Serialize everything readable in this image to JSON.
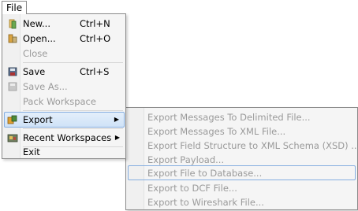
{
  "menubar": {
    "file_label": "File"
  },
  "file_menu": {
    "items": [
      {
        "label": "New...",
        "shortcut": "Ctrl+N",
        "icon": "new-file-icon",
        "enabled": true
      },
      {
        "label": "Open...",
        "shortcut": "Ctrl+O",
        "icon": "open-folder-icon",
        "enabled": true
      },
      {
        "label": "Close",
        "shortcut": "",
        "icon": "",
        "enabled": false
      },
      {
        "label": "Save",
        "shortcut": "Ctrl+S",
        "icon": "save-icon",
        "enabled": true
      },
      {
        "label": "Save As...",
        "shortcut": "",
        "icon": "save-as-icon",
        "enabled": false
      },
      {
        "label": "Pack Workspace",
        "shortcut": "",
        "icon": "",
        "enabled": false
      },
      {
        "label": "Export",
        "shortcut": "",
        "icon": "export-icon",
        "enabled": true,
        "highlighted": true,
        "has_submenu": true
      },
      {
        "label": "Recent Workspaces",
        "shortcut": "",
        "icon": "recent-workspaces-icon",
        "enabled": true,
        "has_submenu": true
      },
      {
        "label": "Exit",
        "shortcut": "",
        "icon": "",
        "enabled": true
      }
    ]
  },
  "export_submenu": {
    "items": [
      {
        "label": "Export Messages To Delimited File...",
        "enabled": false
      },
      {
        "label": "Export Messages To XML File...",
        "enabled": false
      },
      {
        "label": "Export Field Structure to XML Schema (XSD) ...",
        "enabled": false
      },
      {
        "label": "Export Payload...",
        "enabled": false
      },
      {
        "label": "Export File to Database...",
        "enabled": false,
        "highlighted": true
      },
      {
        "label": "Export to DCF File...",
        "enabled": false
      },
      {
        "label": "Export to Wireshark File...",
        "enabled": false
      }
    ]
  },
  "colors": {
    "highlight_border": "#85aee0",
    "disabled_text": "#9a9a9a",
    "menu_bg": "#f5f5f5"
  }
}
